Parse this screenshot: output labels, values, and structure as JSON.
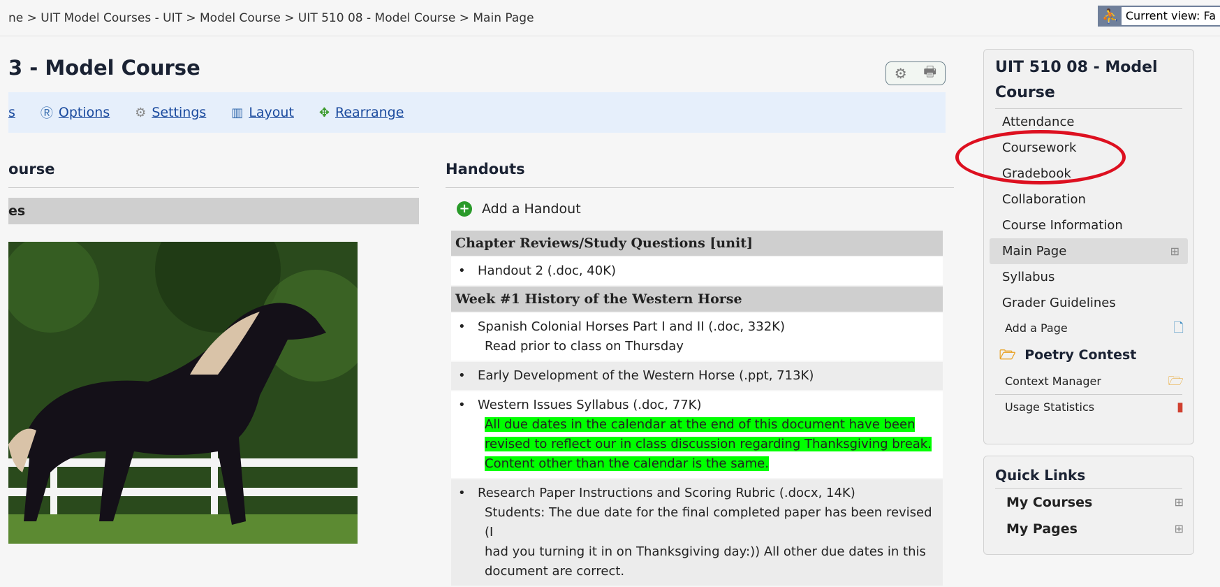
{
  "breadcrumb": "ne > UIT Model Courses - UIT > Model Course > UIT 510 08 - Model Course > Main Page",
  "current_view": {
    "label": "Current view: Fa"
  },
  "page_title": "3 - Model Course",
  "toolbar": {
    "partial": "s",
    "options": "Options",
    "settings": "Settings",
    "layout": "Layout",
    "rearrange": "Rearrange"
  },
  "left_column": {
    "heading": "ourse",
    "bar": "es"
  },
  "handouts": {
    "heading": "Handouts",
    "add_label": "Add a Handout",
    "section1": "Chapter Reviews/Study Questions [unit]",
    "item1": "Handout 2 (.doc, 40K)",
    "section2": "Week #1 History of the Western Horse",
    "item2": "Spanish Colonial Horses Part I and II (.doc, 332K)",
    "item2_note": "Read prior to class on Thursday",
    "item3": "Early Development of the Western Horse (.ppt, 713K)",
    "item4": "Western Issues Syllabus (.doc, 77K)",
    "item4_note1": "All due dates in the calendar at the end of this document have been",
    "item4_note2": "revised to reflect our in class discussion regarding Thanksgiving break.",
    "item4_note3": "Content other than the calendar is the same.",
    "item5": "Research Paper Instructions and Scoring Rubric (.docx, 14K)",
    "item5_note1": "Students:  The due date for the final completed paper has been revised (I",
    "item5_note2": "had you turning it in on Thanksgiving day:)) All other due dates in this",
    "item5_note3": "document are correct."
  },
  "sidebar": {
    "title": "UIT 510 08 - Model Course",
    "attendance": "Attendance",
    "coursework": "Coursework",
    "gradebook": "Gradebook",
    "collaboration": "Collaboration",
    "course_information": "Course Information",
    "main_page": "Main Page",
    "syllabus": "Syllabus",
    "grader_guidelines": "Grader Guidelines",
    "add_page": "Add a Page",
    "poetry_contest": "Poetry Contest",
    "context_manager": "Context Manager",
    "usage_statistics": "Usage Statistics"
  },
  "quick_links": {
    "title": "Quick Links",
    "my_courses": "My Courses",
    "my_pages": "My Pages"
  },
  "colors": {
    "highlight": "#00ff00",
    "annotation_circle": "#dd1020",
    "link": "#1a4a9e"
  }
}
